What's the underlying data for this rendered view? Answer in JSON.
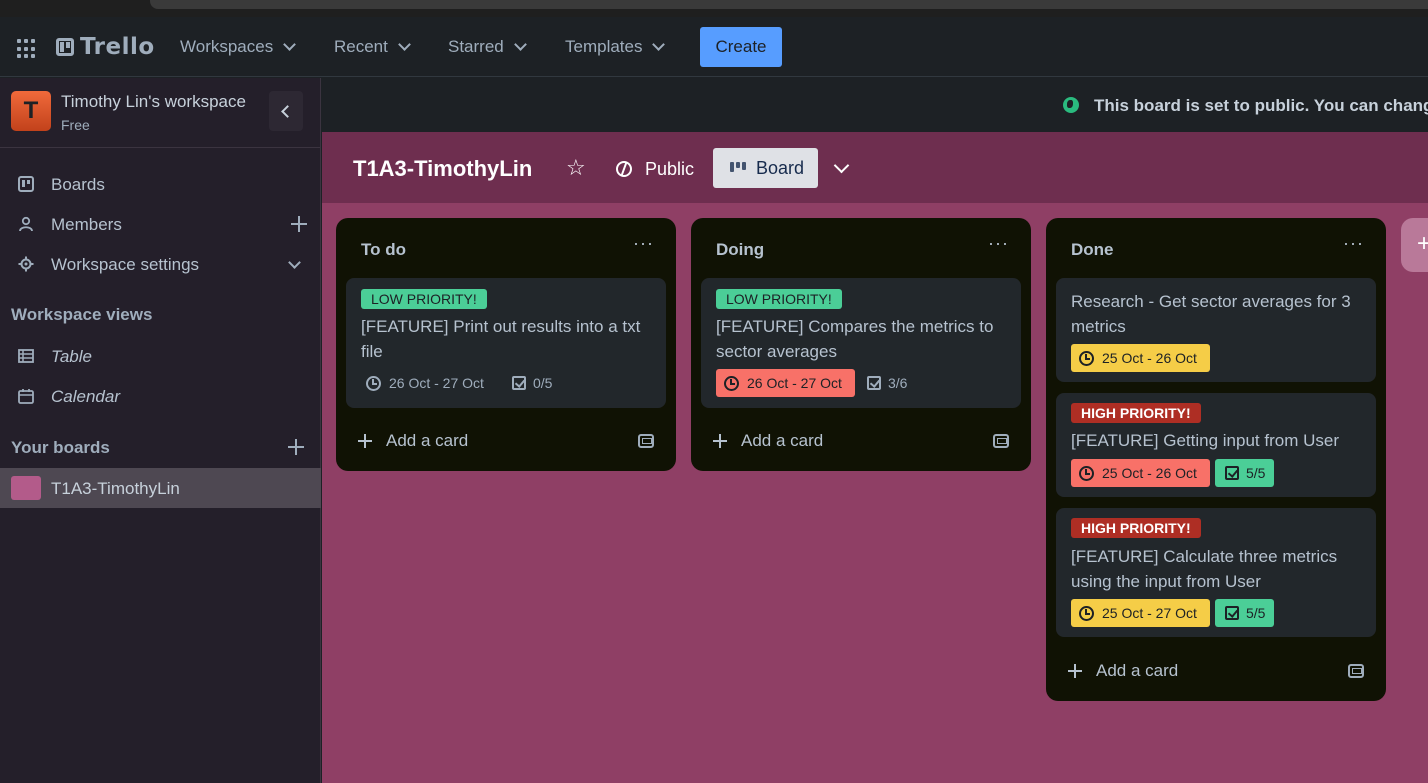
{
  "header": {
    "logo_text": "Trello",
    "nav": [
      "Workspaces",
      "Recent",
      "Starred",
      "Templates"
    ],
    "create_label": "Create"
  },
  "sidebar": {
    "workspace_initial": "T",
    "workspace_name": "Timothy Lin's workspace",
    "workspace_plan": "Free",
    "items": [
      {
        "label": "Boards"
      },
      {
        "label": "Members"
      },
      {
        "label": "Workspace settings"
      }
    ],
    "views_heading": "Workspace views",
    "views": [
      {
        "label": "Table"
      },
      {
        "label": "Calendar"
      }
    ],
    "boards_heading": "Your boards",
    "boards": [
      {
        "label": "T1A3-TimothyLin",
        "color": "#b35b8a"
      }
    ]
  },
  "notice": {
    "text": "This board is set to public. You can chang"
  },
  "board": {
    "title": "T1A3-TimothyLin",
    "visibility": "Public",
    "view_label": "Board",
    "background": "#8f3f65"
  },
  "lists": [
    {
      "title": "To do",
      "add_card": "Add a card",
      "cards": [
        {
          "label": "LOW PRIORITY!",
          "title": "[FEATURE] Print out results into a txt file",
          "dates": "26 Oct - 27 Oct",
          "checklist": "0/5"
        }
      ]
    },
    {
      "title": "Doing",
      "add_card": "Add a card",
      "cards": [
        {
          "label": "LOW PRIORITY!",
          "title": "[FEATURE] Compares the metrics to sector averages",
          "dates": "26 Oct - 27 Oct",
          "checklist": "3/6"
        }
      ]
    },
    {
      "title": "Done",
      "add_card": "Add a card",
      "cards": [
        {
          "label": "",
          "title": "Research - Get sector averages for 3 metrics",
          "dates": "25 Oct - 26 Oct",
          "checklist": ""
        },
        {
          "label": "HIGH PRIORITY!",
          "title": "[FEATURE] Getting input from User",
          "dates": "25 Oct - 26 Oct",
          "checklist": "5/5"
        },
        {
          "label": "HIGH PRIORITY!",
          "title": "[FEATURE] Calculate three metrics using the input from User",
          "dates": "25 Oct - 27 Oct",
          "checklist": "5/5"
        }
      ]
    }
  ],
  "colors": {
    "accent": "#579dff",
    "low_priority": "#4bce97",
    "high_priority": "#ae2e24",
    "overdue": "#f87168",
    "due_soon": "#f5cd47"
  }
}
